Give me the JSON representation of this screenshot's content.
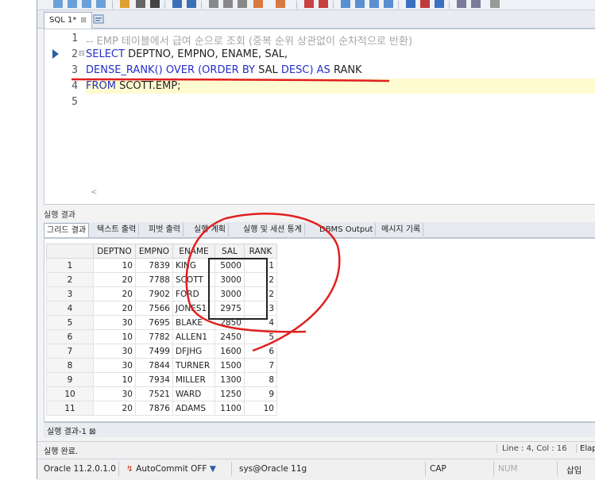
{
  "editor_tab": {
    "label": "SQL 1*",
    "close": "⊠"
  },
  "editor": {
    "lines": [
      {
        "num": "1",
        "parts": [
          {
            "cls": "comment",
            "text": "-- EMP 테이블에서 급여 순으로 조회 (중복 순위 상관없이 순차적으로 반환)"
          }
        ]
      },
      {
        "num": "2",
        "parts": [
          {
            "cls": "kw",
            "text": "SELECT "
          },
          {
            "cls": "txt",
            "text": "DEPTNO, EMPNO, ENAME, SAL,"
          }
        ]
      },
      {
        "num": "3",
        "parts": [
          {
            "cls": "kw",
            "text": "DENSE_RANK() OVER (ORDER BY "
          },
          {
            "cls": "txt",
            "text": "SAL "
          },
          {
            "cls": "kw",
            "text": "DESC) AS "
          },
          {
            "cls": "txt",
            "text": "RANK"
          }
        ]
      },
      {
        "num": "4",
        "parts": [
          {
            "cls": "kw",
            "text": "FROM "
          },
          {
            "cls": "txt",
            "text": "SCOTT.EMP;"
          }
        ]
      },
      {
        "num": "5",
        "parts": []
      }
    ],
    "scroll_left": "<"
  },
  "results": {
    "title": "실행 결과",
    "tabs": [
      "그리드 결과",
      "텍스트 출력",
      "피벗 출력",
      "실행 계획",
      "실행 및 세션 통계",
      "DBMS Output",
      "메시지 기록"
    ],
    "columns": [
      "DEPTNO",
      "EMPNO",
      "ENAME",
      "SAL",
      "RANK"
    ],
    "rows": [
      [
        "1",
        "10",
        "7839",
        "KING",
        "5000",
        "1"
      ],
      [
        "2",
        "20",
        "7788",
        "SCOTT",
        "3000",
        "2"
      ],
      [
        "3",
        "20",
        "7902",
        "FORD",
        "3000",
        "2"
      ],
      [
        "4",
        "20",
        "7566",
        "JONES1",
        "2975",
        "3"
      ],
      [
        "5",
        "30",
        "7695",
        "BLAKE",
        "2850",
        "4"
      ],
      [
        "6",
        "10",
        "7782",
        "ALLEN1",
        "2450",
        "5"
      ],
      [
        "7",
        "30",
        "7499",
        "DFJHG",
        "1600",
        "6"
      ],
      [
        "8",
        "30",
        "7844",
        "TURNER",
        "1500",
        "7"
      ],
      [
        "9",
        "10",
        "7934",
        "MILLER",
        "1300",
        "8"
      ],
      [
        "10",
        "30",
        "7521",
        "WARD",
        "1250",
        "9"
      ],
      [
        "11",
        "20",
        "7876",
        "ADAMS",
        "1100",
        "10"
      ]
    ],
    "bottom_tab": "실행 결과-1 ⊠"
  },
  "status": {
    "message": "실행 완료.",
    "line_col": "Line : 4, Col : 16",
    "elapsed": "Elap"
  },
  "bottom_bar": {
    "version": "Oracle 11.2.0.1.0",
    "autocommit": "AutoCommit OFF",
    "connection": "sys@Oracle 11g",
    "cap": "CAP",
    "num": "NUM",
    "insert": "삽입"
  },
  "colors": {
    "annotation_red": "#e02020",
    "keyword_blue": "#2530c8"
  }
}
